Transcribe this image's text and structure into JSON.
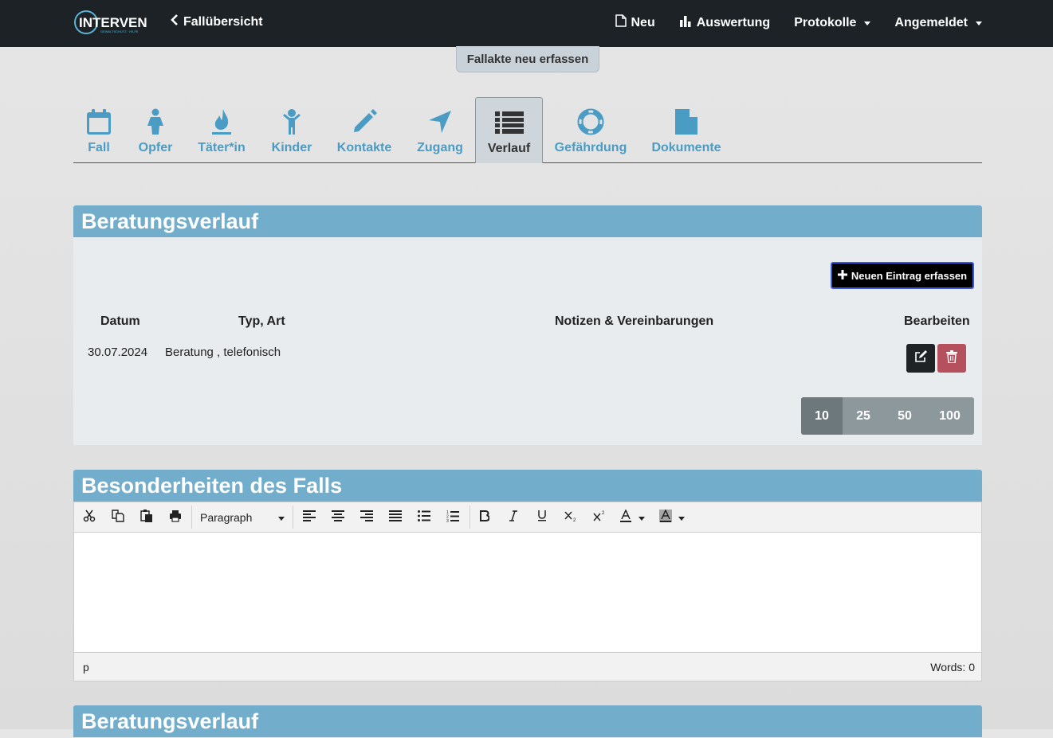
{
  "header": {
    "logo_text": "INTERVENT",
    "back_label": "Fallübersicht",
    "nav": [
      {
        "label": "Neu",
        "icon": "file-icon"
      },
      {
        "label": "Auswertung",
        "icon": "bar-chart-icon"
      },
      {
        "label": "Protokolle",
        "dropdown": true
      },
      {
        "label": "Angemeldet",
        "dropdown": true
      }
    ]
  },
  "badge": "Fallakte neu erfassen",
  "tabs": [
    {
      "label": "Fall",
      "icon": "calendar-icon"
    },
    {
      "label": "Opfer",
      "icon": "person-female-icon"
    },
    {
      "label": "Täter*in",
      "icon": "fire-icon"
    },
    {
      "label": "Kinder",
      "icon": "child-icon"
    },
    {
      "label": "Kontakte",
      "icon": "pencil-icon"
    },
    {
      "label": "Zugang",
      "icon": "location-arrow-icon"
    },
    {
      "label": "Verlauf",
      "icon": "list-icon",
      "active": true
    },
    {
      "label": "Gefährdung",
      "icon": "life-ring-icon"
    },
    {
      "label": "Dokumente",
      "icon": "document-icon"
    }
  ],
  "verlauf": {
    "title": "Beratungsverlauf",
    "new_button": "Neuen Eintrag erfassen",
    "columns": [
      "Datum",
      "Typ, Art",
      "Notizen & Vereinbarungen",
      "Bearbeiten"
    ],
    "rows": [
      {
        "datum": "30.07.2024",
        "typ": "Beratung , telefonisch",
        "notizen": ""
      }
    ],
    "page_sizes": [
      "10",
      "25",
      "50",
      "100"
    ],
    "selected_page_size": "10",
    "colors": {
      "edit": "#1f2326",
      "delete": "#b5505d"
    }
  },
  "besonderheiten": {
    "title": "Besonderheiten des Falls",
    "format": "Paragraph",
    "status_path": "p",
    "word_count": "Words: 0"
  },
  "verlauf2": {
    "title": "Beratungsverlauf"
  },
  "colors": {
    "accent": "#4a9cc5",
    "panel_header": "#72aecb",
    "topbar": "#1c2226"
  }
}
